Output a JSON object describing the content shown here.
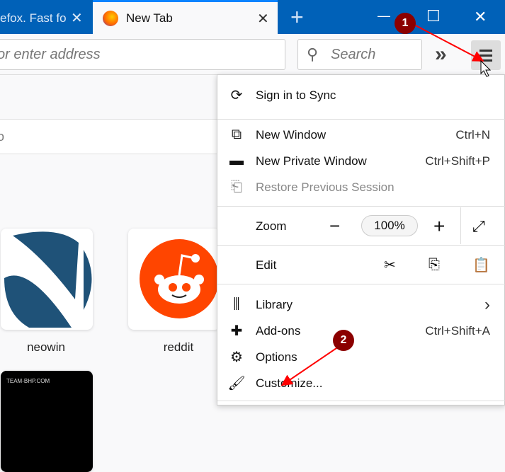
{
  "tabs": [
    {
      "title": "efox. Fast fo",
      "close": "✕"
    },
    {
      "title": "New Tab",
      "close": "✕",
      "active": true
    }
  ],
  "new_tab": "+",
  "window": {
    "minimize": "—",
    "maximize": "☐",
    "close": "✕"
  },
  "nav": {
    "url_placeholder": "or enter address",
    "search_placeholder": "Search",
    "overflow": "»"
  },
  "content": {
    "search_fragment": "o",
    "tiles": [
      {
        "label": "neowin"
      },
      {
        "label": "reddit"
      },
      {
        "label": "TEAM-BHP.COM"
      }
    ]
  },
  "menu": {
    "sync": "Sign in to Sync",
    "new_window": {
      "label": "New Window",
      "shortcut": "Ctrl+N"
    },
    "private_window": {
      "label": "New Private Window",
      "shortcut": "Ctrl+Shift+P"
    },
    "restore": "Restore Previous Session",
    "zoom": {
      "label": "Zoom",
      "minus": "−",
      "value": "100%",
      "plus": "+"
    },
    "edit": {
      "label": "Edit"
    },
    "library": {
      "label": "Library",
      "arrow": "›"
    },
    "addons": {
      "label": "Add-ons",
      "shortcut": "Ctrl+Shift+A"
    },
    "options": "Options",
    "customize": "Customize..."
  },
  "annotations": [
    "1",
    "2"
  ],
  "colors": {
    "tabbar": "#0061b8",
    "annotation": "#8b0000",
    "arrow": "#ff0000",
    "reddit": "#ff4500",
    "neowin": "#1f5278"
  }
}
